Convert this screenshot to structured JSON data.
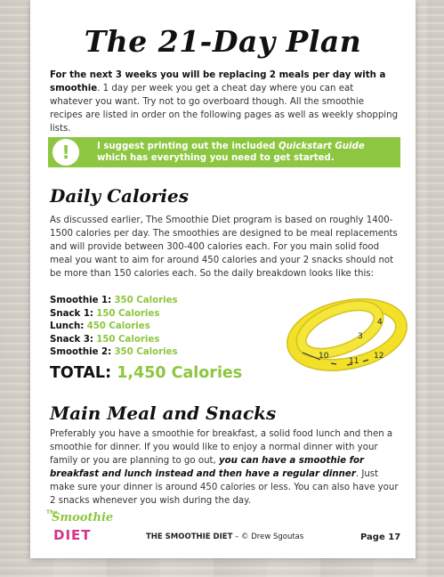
{
  "title": "The 21-Day Plan",
  "intro": {
    "bold": "For the next 3 weeks you will be replacing 2 meals per day with a smoothie",
    "rest": ". 1 day per week you get a cheat day where you can eat whatever you want. Try not to go overboard though. All the smoothie recipes are listed in order on the following pages as well as weekly shopping lists."
  },
  "tip": {
    "icon": "!",
    "before": "I suggest printing out the included ",
    "italic": "Quickstart Guide",
    "after": " which has everything you need to get started."
  },
  "daily": {
    "heading": "Daily Calories",
    "paragraph": "As discussed earlier, The Smoothie Diet program is based on roughly 1400-1500 calories per day. The smoothies are designed to be meal replacements and will provide between 300-400 calories each. For you main solid food meal you want to aim for around 450 calories and your 2 snacks should not be more than 150 calories each. So the daily breakdown looks like this:",
    "items": [
      {
        "label": "Smoothie 1:",
        "value": "350 Calories"
      },
      {
        "label": "Snack 1:",
        "value": "150 Calories"
      },
      {
        "label": "Lunch:",
        "value": "450 Calories"
      },
      {
        "label": "Snack 3:",
        "value": "150 Calories"
      },
      {
        "label": "Smoothie 2:",
        "value": "350 Calories"
      }
    ],
    "total_label": "TOTAL:",
    "total_value": "1,450 Calories"
  },
  "main": {
    "heading": "Main Meal and Snacks",
    "p1": "Preferably you have a smoothie for breakfast, a solid food lunch and then a smoothie for dinner. If you would like to enjoy a normal dinner with your family or you are planning to go out, ",
    "bold": "you can have a smoothie for breakfast and lunch instead and then have a regular dinner",
    "p2": ". Just make sure your dinner is around 450 calories or less. You can also have your 2 snacks whenever you wish during the day."
  },
  "footer": {
    "logo_the": "The",
    "logo_smoothie": "Smoothie",
    "logo_diet": "DIET",
    "brand": "THE SMOOTHIE DIET",
    "credit": " – © Drew Sgoutas",
    "page": "Page 17"
  },
  "colors": {
    "accent_green": "#8dc640",
    "logo_pink": "#d6338a",
    "tape_yellow": "#f2e029"
  },
  "icons": [
    "exclamation-icon",
    "measuring-tape-image"
  ]
}
